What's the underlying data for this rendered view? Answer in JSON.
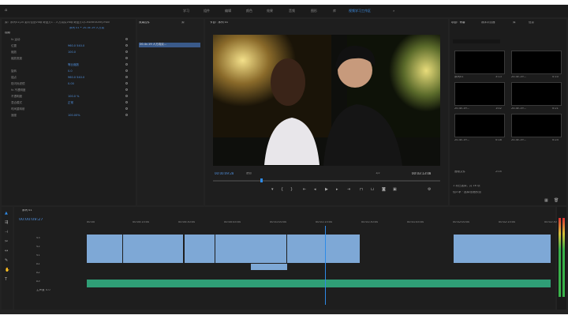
{
  "workspaces": [
    "学习",
    "组件",
    "编辑",
    "颜色",
    "效果",
    "音频",
    "图形",
    "库",
    "视频学习工作区",
    "»"
  ],
  "active_workspace": "视频学习工作区",
  "effect_controls": {
    "source_label": "源：序列01(20 影片包含Vlog 奇迹方1 - 人方真实Vlog 奇迹方1(Ch4c6f4f26f).mov",
    "tab": "序列 01 • 20-4c-19 人方真",
    "section_video": "视频",
    "rows": [
      {
        "label": "fx 运动",
        "value": ""
      },
      {
        "label": "位置",
        "value": "960.0   540.0"
      },
      {
        "label": "缩放",
        "value": "100.0"
      },
      {
        "label": "缩放宽度",
        "value": ""
      },
      {
        "label": "",
        "value": "等比缩放"
      },
      {
        "label": "旋转",
        "value": "0.0"
      },
      {
        "label": "锚点",
        "value": "960.0  540.0"
      },
      {
        "label": "防闪烁滤镜",
        "value": "0.00"
      },
      {
        "label": "fx 不透明度",
        "value": ""
      },
      {
        "label": "不透明度",
        "value": "100.0 %"
      },
      {
        "label": "混合模式",
        "value": "正常"
      },
      {
        "label": "时间重映射",
        "value": ""
      },
      {
        "label": "速度",
        "value": "100.00%"
      }
    ],
    "mini_tabs": [
      "效果控件",
      "源"
    ],
    "mini_clip": "20-4c-19 人方真实..."
  },
  "program": {
    "title": "节目：序列 01",
    "timecode_left": "00:00:09:28",
    "fit": "适合",
    "ratio": "1/2",
    "timecode_right": "00:03:13:08"
  },
  "project": {
    "tabs": [
      "项目：青春",
      "媒体浏览器",
      "库",
      "信息"
    ],
    "search_placeholder": "",
    "items_count": "1 项已选择，共 16 项",
    "thumbs": [
      {
        "label": "序列01",
        "dur": "3:13"
      },
      {
        "label": "20-4c-19...",
        "dur": "0:10"
      },
      {
        "label": "20-4c-19...",
        "dur": "1:02"
      },
      {
        "label": "20-4c-19...",
        "dur": "0:21"
      },
      {
        "label": "20-4c-19...",
        "dur": "0:18"
      },
      {
        "label": "20-4c-19...",
        "dur": "0:24"
      },
      {
        "label": "音频文件",
        "dur": "2:05"
      }
    ],
    "bottom_text": "仙人掌 · 选择/查看预览"
  },
  "timeline": {
    "title": "序列 01",
    "timecode": "00:00:09:27",
    "ruler": [
      "00:00",
      "00:00:15:00",
      "00:00:30:00",
      "00:00:45:00",
      "00:01:00:00",
      "00:01:15:00",
      "00:01:30:00",
      "00:01:45:00",
      "00:02:00:00",
      "00:02:15:00",
      "00:02:30:00"
    ],
    "tracks": [
      "V3",
      "V2",
      "V1",
      "A1",
      "A2",
      "A3",
      "主声道"
    ],
    "master_value": "0.0"
  },
  "colors": {
    "accent": "#2e8ae6",
    "clip": "#7ea8d6",
    "audio": "#2f9e76",
    "bg": "#232323"
  }
}
